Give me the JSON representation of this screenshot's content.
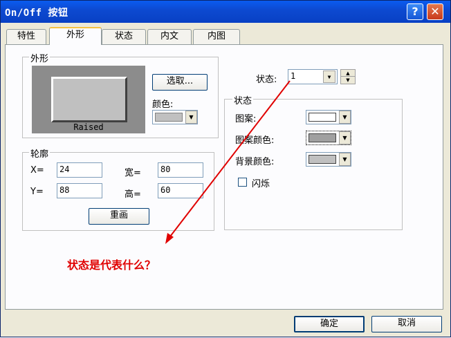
{
  "window": {
    "title": "On/Off 按钮",
    "help_glyph": "?",
    "close_glyph": "✕"
  },
  "tabs": [
    {
      "label": "特性",
      "active": false
    },
    {
      "label": "外形",
      "active": true
    },
    {
      "label": "状态",
      "active": false
    },
    {
      "label": "内文",
      "active": false
    },
    {
      "label": "内图",
      "active": false
    }
  ],
  "shape_group": {
    "label": "外形",
    "preview_caption": "Raised",
    "select_button": "选取...",
    "color_label": "颜色:",
    "color_swatch": "#c0c0c0"
  },
  "outline_group": {
    "label": "轮廓",
    "x_label": "X=",
    "x_value": "24",
    "y_label": "Y=",
    "y_value": "88",
    "w_label": "宽=",
    "w_value": "80",
    "h_label": "高=",
    "h_value": "60",
    "redraw_button": "重画"
  },
  "state_selector": {
    "label": "状态:",
    "value": "1",
    "arrow_glyph": "▼",
    "spin_up": "▲",
    "spin_down": "▼"
  },
  "state_group": {
    "label": "状态",
    "pattern_label": "图案:",
    "pattern_color": "#ffffff",
    "pattern_color_label": "图案颜色:",
    "pattern_color_value": "#a0a0a0",
    "bg_color_label": "背景颜色:",
    "bg_color_value": "#c0c0c0",
    "blink_label": "闪烁",
    "blink_checked": false,
    "dd_glyph": "▼"
  },
  "annotation": {
    "text": "状态是代表什么？",
    "color": "#e00000"
  },
  "footer": {
    "ok_button": "确定",
    "cancel_button": "取消"
  }
}
